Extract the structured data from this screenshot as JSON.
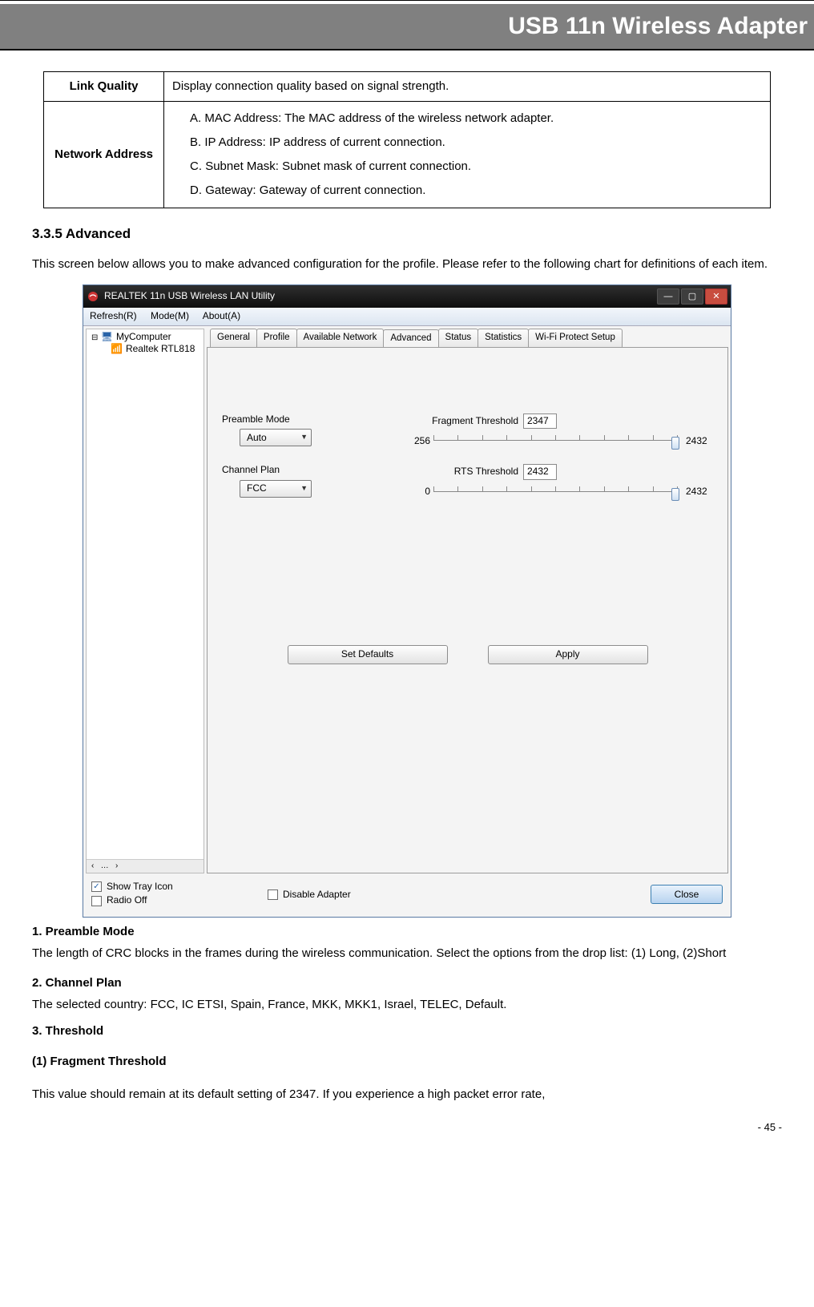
{
  "header": {
    "title": "USB 11n Wireless Adapter"
  },
  "table": {
    "row1": {
      "label": "Link Quality",
      "desc": "Display connection quality based on signal strength."
    },
    "row2": {
      "label": "Network Address",
      "a": "A.    MAC Address: The MAC address of the wireless network adapter.",
      "b": "B.    IP Address: IP address of current connection.",
      "c": "C.    Subnet Mask: Subnet mask of current connection.",
      "d": "D.    Gateway: Gateway of current connection."
    }
  },
  "section": {
    "num_title": "3.3.5   Advanced",
    "intro": "This screen below allows you to make advanced configuration for the profile. Please refer to the following chart for definitions of each item."
  },
  "app": {
    "title": "REALTEK 11n USB Wireless LAN Utility",
    "menu": {
      "refresh": "Refresh(R)",
      "mode": "Mode(M)",
      "about": "About(A)"
    },
    "tree": {
      "root": "MyComputer",
      "child": "Realtek RTL818",
      "scroll_marker": "…"
    },
    "tabs": {
      "general": "General",
      "profile": "Profile",
      "available": "Available Network",
      "advanced": "Advanced",
      "status": "Status",
      "statistics": "Statistics",
      "wifi": "Wi-Fi Protect Setup"
    },
    "controls": {
      "preamble_label": "Preamble Mode",
      "preamble_value": "Auto",
      "channel_label": "Channel Plan",
      "channel_value": "FCC",
      "frag_label": "Fragment Threshold",
      "frag_value": "2347",
      "frag_min": "256",
      "frag_max": "2432",
      "rts_label": "RTS Threshold",
      "rts_value": "2432",
      "rts_min": "0",
      "rts_max": "2432"
    },
    "buttons": {
      "defaults": "Set Defaults",
      "apply": "Apply",
      "close": "Close"
    },
    "bottom": {
      "show_tray": "Show Tray Icon",
      "radio_off": "Radio Off",
      "disable": "Disable Adapter"
    }
  },
  "body": {
    "h1": "1. Preamble Mode",
    "p1": "The length of CRC blocks in the frames during the wireless communication. Select the options from the drop list: (1) Long, (2)Short",
    "h2": "2. Channel Plan",
    "p2": "The selected country: FCC, IC ETSI, Spain, France, MKK, MKK1, Israel, TELEC, Default.",
    "h3": "3. Threshold",
    "h4": "(1) Fragment Threshold",
    "p4": "This value should remain at its default setting of 2347. If you experience a high packet error rate,"
  },
  "page_number": "- 45 -"
}
